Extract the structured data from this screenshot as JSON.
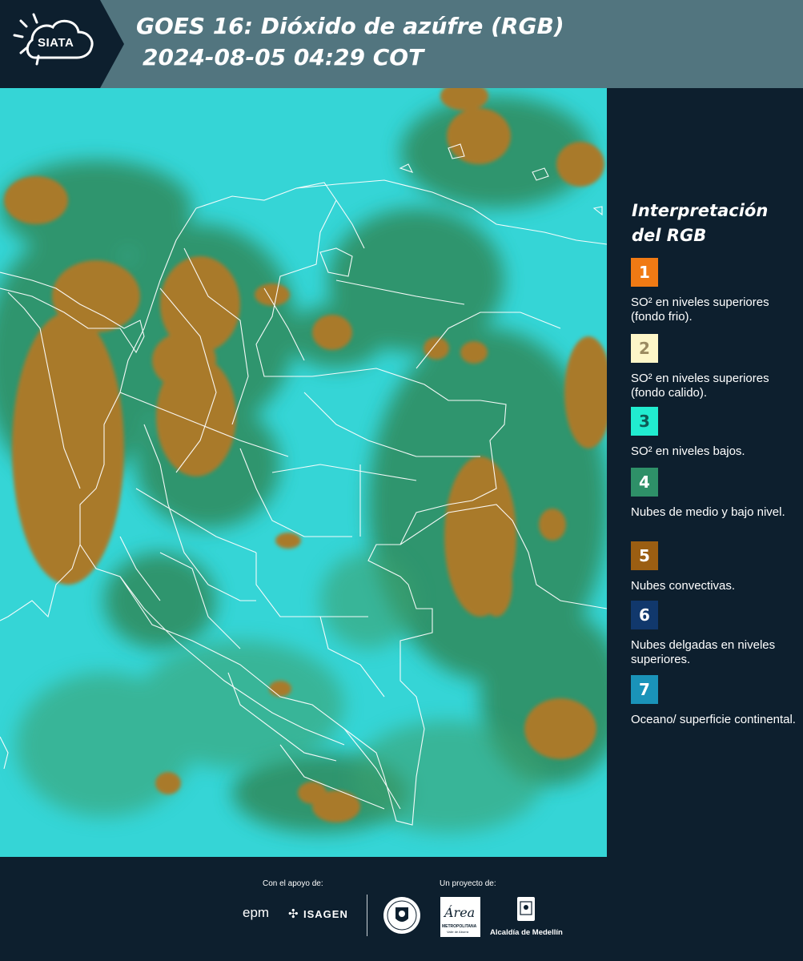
{
  "header": {
    "logo_text": "SIATA",
    "title": "GOES 16: Dióxido de azúfre (RGB)",
    "timestamp": "2024-08-05 04:29 COT"
  },
  "legend": {
    "title": "Interpretación del RGB",
    "items": [
      {
        "number": "1",
        "color": "#f07a14",
        "text_color": "#ffffff",
        "label": "SO² en niveles superiores (fondo frio)."
      },
      {
        "number": "2",
        "color": "#fdf6c8",
        "text_color": "#9a8a60",
        "label": "SO² en niveles superiores (fondo calido)."
      },
      {
        "number": "3",
        "color": "#21ecd0",
        "text_color": "#0e5a55",
        "label": "SO² en niveles bajos."
      },
      {
        "number": "4",
        "color": "#2e9068",
        "text_color": "#ffffff",
        "label": "Nubes de medio y bajo nivel."
      },
      {
        "number": "5",
        "color": "#9b5e12",
        "text_color": "#ffffff",
        "label": "Nubes convectivas."
      },
      {
        "number": "6",
        "color": "#11386c",
        "text_color": "#ffffff",
        "label": "Nubes delgadas en niveles superiores."
      },
      {
        "number": "7",
        "color": "#1a93b9",
        "text_color": "#ffffff",
        "label": "Oceano/ superficie continental."
      }
    ]
  },
  "footer": {
    "support_label": "Con el apoyo de:",
    "project_label": "Un proyecto de:",
    "epm": "epm",
    "isagen": "ISAGEN",
    "metropolitana": "METROPOLITANA",
    "area": "Área",
    "valle": "Valle de Aburrá",
    "alcaldia": "Alcaldía de Medellín"
  },
  "map": {
    "ocean_color": "#35d5d6",
    "cloud_color": "#a87a2e",
    "mid_cloud_color": "#2f7d4f",
    "border_color": "#ffffff"
  }
}
